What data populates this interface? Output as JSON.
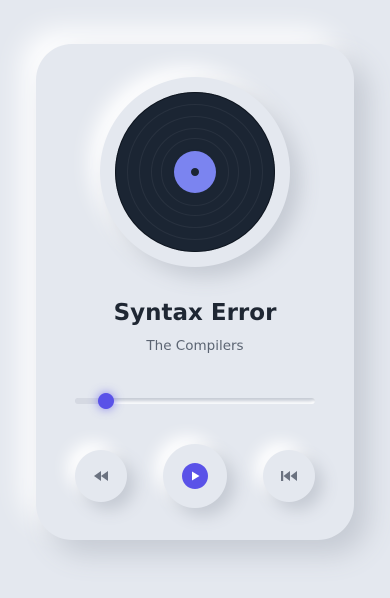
{
  "track": {
    "title": "Syntax Error",
    "artist": "The Compilers"
  },
  "progress": {
    "fraction": 0.13
  },
  "controls": {
    "prev_icon": "rewind-icon",
    "play_icon": "play-icon",
    "next_icon": "skip-back-icon"
  },
  "colors": {
    "background": "#e4e8ef",
    "accent": "#5a52e8",
    "disc": "#1b2533",
    "disc_label": "#7b84f0",
    "title_text": "#1f2733",
    "artist_text": "#5b6472"
  }
}
